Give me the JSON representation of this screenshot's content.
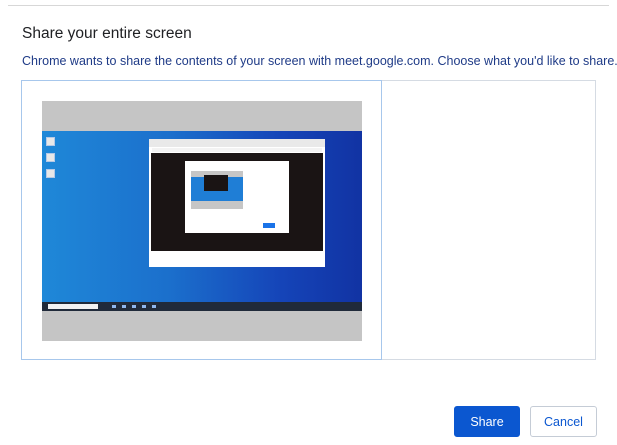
{
  "dialog": {
    "title": "Share your entire screen",
    "subtitle": "Chrome wants to share the contents of your screen with meet.google.com. Choose what you'd like to share."
  },
  "buttons": {
    "share": "Share",
    "cancel": "Cancel"
  },
  "colors": {
    "accent": "#0b57d0",
    "subtitle_text": "#1f3b87",
    "selected_border": "#a7c7ec"
  }
}
